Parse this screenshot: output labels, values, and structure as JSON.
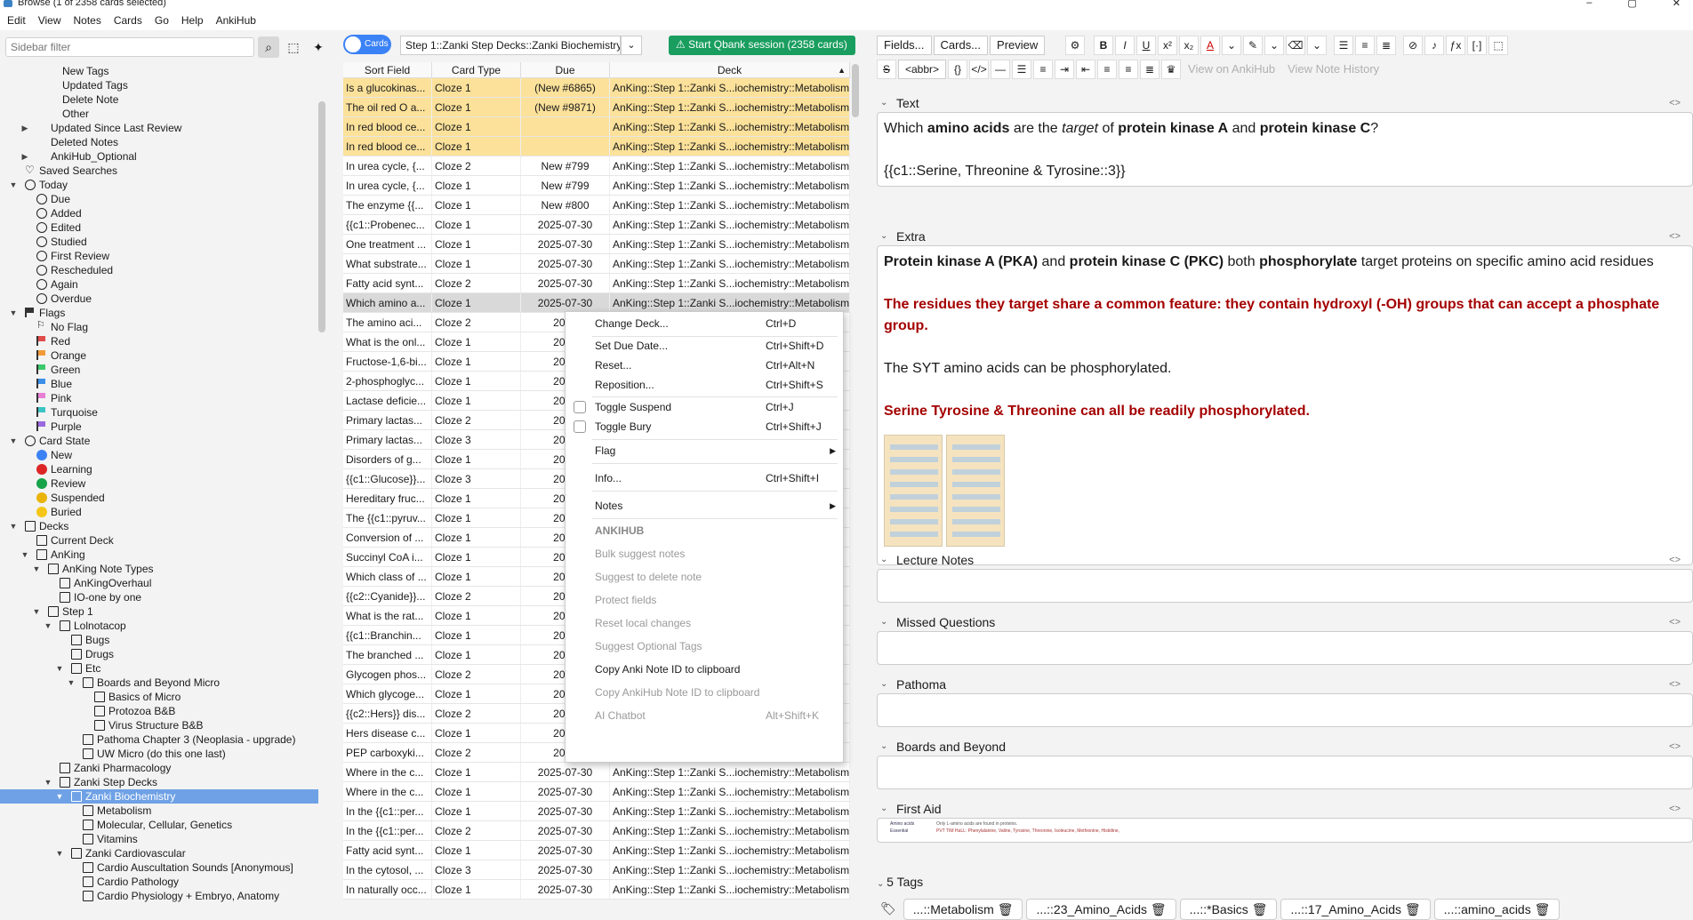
{
  "window": {
    "title": "Browse (1 of 2358 cards selected)"
  },
  "menu": [
    "Edit",
    "View",
    "Notes",
    "Cards",
    "Go",
    "Help",
    "AnkiHub"
  ],
  "sidebar": {
    "filter_placeholder": "Sidebar filter",
    "tree": [
      {
        "label": "New Tags",
        "level": 3,
        "icon": "none"
      },
      {
        "label": "Updated Tags",
        "level": 3,
        "icon": "none"
      },
      {
        "label": "Delete Note",
        "level": 3,
        "icon": "none"
      },
      {
        "label": "Other",
        "level": 3,
        "icon": "none"
      },
      {
        "label": "Updated Since Last Review",
        "level": 2,
        "icon": "none",
        "arrow": "right"
      },
      {
        "label": "Deleted Notes",
        "level": 2,
        "icon": "none"
      },
      {
        "label": "AnkiHub_Optional",
        "level": 2,
        "icon": "none",
        "arrow": "right"
      },
      {
        "label": "Saved Searches",
        "level": 1,
        "icon": "heart"
      },
      {
        "label": "Today",
        "level": 1,
        "icon": "clock",
        "arrow": "down"
      },
      {
        "label": "Due",
        "level": 2,
        "icon": "clock"
      },
      {
        "label": "Added",
        "level": 2,
        "icon": "clock"
      },
      {
        "label": "Edited",
        "level": 2,
        "icon": "clock"
      },
      {
        "label": "Studied",
        "level": 2,
        "icon": "clock"
      },
      {
        "label": "First Review",
        "level": 2,
        "icon": "clock"
      },
      {
        "label": "Rescheduled",
        "level": 2,
        "icon": "clock"
      },
      {
        "label": "Again",
        "level": 2,
        "icon": "clock"
      },
      {
        "label": "Overdue",
        "level": 2,
        "icon": "clock"
      },
      {
        "label": "Flags",
        "level": 1,
        "icon": "flag",
        "color": "#333333",
        "arrow": "down"
      },
      {
        "label": "No Flag",
        "level": 2,
        "icon": "noflag"
      },
      {
        "label": "Red",
        "level": 2,
        "icon": "flag",
        "color": "#e24b4b"
      },
      {
        "label": "Orange",
        "level": 2,
        "icon": "flag",
        "color": "#f29a38"
      },
      {
        "label": "Green",
        "level": 2,
        "icon": "flag",
        "color": "#3cc96b"
      },
      {
        "label": "Blue",
        "level": 2,
        "icon": "flag",
        "color": "#3b8fe8"
      },
      {
        "label": "Pink",
        "level": 2,
        "icon": "flag",
        "color": "#e77fd5"
      },
      {
        "label": "Turquoise",
        "level": 2,
        "icon": "flag",
        "color": "#3ac4c4"
      },
      {
        "label": "Purple",
        "level": 2,
        "icon": "flag",
        "color": "#9a6adf"
      },
      {
        "label": "Card State",
        "level": 1,
        "icon": "circle",
        "arrow": "down"
      },
      {
        "label": "New",
        "level": 2,
        "icon": "dot",
        "color": "#3b82f6"
      },
      {
        "label": "Learning",
        "level": 2,
        "icon": "dot",
        "color": "#dc2626"
      },
      {
        "label": "Review",
        "level": 2,
        "icon": "dot",
        "color": "#16a34a"
      },
      {
        "label": "Suspended",
        "level": 2,
        "icon": "dot",
        "color": "#eab308"
      },
      {
        "label": "Buried",
        "level": 2,
        "icon": "dot",
        "color": "#f5c518"
      },
      {
        "label": "Decks",
        "level": 1,
        "icon": "deck",
        "arrow": "down"
      },
      {
        "label": "Current Deck",
        "level": 2,
        "icon": "deck"
      },
      {
        "label": "AnKing",
        "level": 2,
        "icon": "deck",
        "arrow": "down"
      },
      {
        "label": "AnKing Note Types",
        "level": 3,
        "icon": "deck",
        "arrow": "down"
      },
      {
        "label": "AnKingOverhaul",
        "level": 4,
        "icon": "deck"
      },
      {
        "label": "IO-one by one",
        "level": 4,
        "icon": "deck"
      },
      {
        "label": "Step 1",
        "level": 3,
        "icon": "deck",
        "arrow": "down"
      },
      {
        "label": "Lolnotacop",
        "level": 4,
        "icon": "deck",
        "arrow": "down"
      },
      {
        "label": "Bugs",
        "level": 5,
        "icon": "deck"
      },
      {
        "label": "Drugs",
        "level": 5,
        "icon": "deck"
      },
      {
        "label": "Etc",
        "level": 5,
        "icon": "deck",
        "arrow": "down"
      },
      {
        "label": "Boards and Beyond Micro",
        "level": 6,
        "icon": "deck",
        "arrow": "down"
      },
      {
        "label": "Basics of Micro",
        "level": 7,
        "icon": "deck"
      },
      {
        "label": "Protozoa B&B",
        "level": 7,
        "icon": "deck"
      },
      {
        "label": "Virus Structure B&B",
        "level": 7,
        "icon": "deck"
      },
      {
        "label": "Pathoma Chapter 3 (Neoplasia - upgrade)",
        "level": 6,
        "icon": "deck"
      },
      {
        "label": "UW Micro (do this one last)",
        "level": 6,
        "icon": "deck"
      },
      {
        "label": "Zanki Pharmacology",
        "level": 4,
        "icon": "deck"
      },
      {
        "label": "Zanki Step Decks",
        "level": 4,
        "icon": "deck",
        "arrow": "down"
      },
      {
        "label": "Zanki Biochemistry",
        "level": 5,
        "icon": "deck",
        "arrow": "down",
        "selected": true
      },
      {
        "label": "Metabolism",
        "level": 6,
        "icon": "deck"
      },
      {
        "label": "Molecular, Cellular, Genetics",
        "level": 6,
        "icon": "deck"
      },
      {
        "label": "Vitamins",
        "level": 6,
        "icon": "deck"
      },
      {
        "label": "Zanki Cardiovascular",
        "level": 5,
        "icon": "deck",
        "arrow": "down"
      },
      {
        "label": "Cardio Auscultation Sounds [Anonymous]",
        "level": 6,
        "icon": "deck"
      },
      {
        "label": "Cardio Pathology",
        "level": 6,
        "icon": "deck"
      },
      {
        "label": "Cardio Physiology + Embryo, Anatomy",
        "level": 6,
        "icon": "deck"
      }
    ]
  },
  "toolbar": {
    "cards_toggle": "Cards",
    "deck_search": "Step 1::Zanki Step Decks::Zanki Biochemistry\"",
    "qbank_label": "Start Qbank session (2358 cards)"
  },
  "table": {
    "columns": [
      "Sort Field",
      "Card Type",
      "Due",
      "Deck"
    ],
    "rows": [
      {
        "sort": "Is a glucokinas...",
        "type": "Cloze 1",
        "due": "(New #6865)",
        "deck": "AnKing::Step 1::Zanki S...iochemistry::Metabolism",
        "state": "hl"
      },
      {
        "sort": "The oil red O a...",
        "type": "Cloze 1",
        "due": "(New #9871)",
        "deck": "AnKing::Step 1::Zanki S...iochemistry::Metabolism",
        "state": "hl"
      },
      {
        "sort": "In red blood ce...",
        "type": "Cloze 1",
        "due": "",
        "deck": "AnKing::Step 1::Zanki S...iochemistry::Metabolism",
        "state": "hl"
      },
      {
        "sort": "In red blood ce...",
        "type": "Cloze 1",
        "due": "",
        "deck": "AnKing::Step 1::Zanki S...iochemistry::Metabolism",
        "state": "hl"
      },
      {
        "sort": "In urea cycle, {...",
        "type": "Cloze 2",
        "due": "New #799",
        "deck": "AnKing::Step 1::Zanki S...iochemistry::Metabolism",
        "state": ""
      },
      {
        "sort": "In urea cycle, {...",
        "type": "Cloze 1",
        "due": "New #799",
        "deck": "AnKing::Step 1::Zanki S...iochemistry::Metabolism",
        "state": ""
      },
      {
        "sort": "The enzyme {{...",
        "type": "Cloze 1",
        "due": "New #800",
        "deck": "AnKing::Step 1::Zanki S...iochemistry::Metabolism",
        "state": ""
      },
      {
        "sort": "{{c1::Probenec...",
        "type": "Cloze 1",
        "due": "2025-07-30",
        "deck": "AnKing::Step 1::Zanki S...iochemistry::Metabolism",
        "state": ""
      },
      {
        "sort": "One treatment ...",
        "type": "Cloze 1",
        "due": "2025-07-30",
        "deck": "AnKing::Step 1::Zanki S...iochemistry::Metabolism",
        "state": ""
      },
      {
        "sort": "What substrate...",
        "type": "Cloze 1",
        "due": "2025-07-30",
        "deck": "AnKing::Step 1::Zanki S...iochemistry::Metabolism",
        "state": ""
      },
      {
        "sort": "Fatty acid synt...",
        "type": "Cloze 2",
        "due": "2025-07-30",
        "deck": "AnKing::Step 1::Zanki S...iochemistry::Metabolism",
        "state": ""
      },
      {
        "sort": "Which amino a...",
        "type": "Cloze 1",
        "due": "2025-07-30",
        "deck": "AnKing::Step 1::Zanki S...iochemistry::Metabolism",
        "state": "sel"
      },
      {
        "sort": "The amino aci...",
        "type": "Cloze 2",
        "due": "2025",
        "deck": "",
        "state": ""
      },
      {
        "sort": "What is the onl...",
        "type": "Cloze 1",
        "due": "2025",
        "deck": "",
        "state": ""
      },
      {
        "sort": "Fructose-1,6-bi...",
        "type": "Cloze 1",
        "due": "2025",
        "deck": "",
        "state": ""
      },
      {
        "sort": "2-phosphoglyc...",
        "type": "Cloze 1",
        "due": "2025",
        "deck": "",
        "state": ""
      },
      {
        "sort": "Lactase deficie...",
        "type": "Cloze 1",
        "due": "2025",
        "deck": "",
        "state": ""
      },
      {
        "sort": "Primary lactas...",
        "type": "Cloze 2",
        "due": "2025",
        "deck": "",
        "state": ""
      },
      {
        "sort": "Primary lactas...",
        "type": "Cloze 3",
        "due": "2025",
        "deck": "",
        "state": ""
      },
      {
        "sort": "Disorders of g...",
        "type": "Cloze 1",
        "due": "2025",
        "deck": "",
        "state": ""
      },
      {
        "sort": "{{c1::Glucose}}...",
        "type": "Cloze 3",
        "due": "2025",
        "deck": "",
        "state": ""
      },
      {
        "sort": "Hereditary fruc...",
        "type": "Cloze 1",
        "due": "2025",
        "deck": "",
        "state": ""
      },
      {
        "sort": "The {{c1::pyruv...",
        "type": "Cloze 1",
        "due": "2025",
        "deck": "",
        "state": ""
      },
      {
        "sort": "Conversion of ...",
        "type": "Cloze 1",
        "due": "2025",
        "deck": "",
        "state": ""
      },
      {
        "sort": "Succinyl CoA i...",
        "type": "Cloze 1",
        "due": "2025",
        "deck": "",
        "state": ""
      },
      {
        "sort": "Which class of ...",
        "type": "Cloze 1",
        "due": "2025",
        "deck": "",
        "state": ""
      },
      {
        "sort": "{{c2::Cyanide}}...",
        "type": "Cloze 2",
        "due": "2025",
        "deck": "",
        "state": ""
      },
      {
        "sort": "What is the rat...",
        "type": "Cloze 1",
        "due": "2025",
        "deck": "",
        "state": ""
      },
      {
        "sort": "{{c1::Branchin...",
        "type": "Cloze 1",
        "due": "2025",
        "deck": "",
        "state": ""
      },
      {
        "sort": "The branched ...",
        "type": "Cloze 1",
        "due": "2025",
        "deck": "",
        "state": ""
      },
      {
        "sort": "Glycogen phos...",
        "type": "Cloze 2",
        "due": "2025",
        "deck": "",
        "state": ""
      },
      {
        "sort": "Which glycoge...",
        "type": "Cloze 1",
        "due": "2025",
        "deck": "",
        "state": ""
      },
      {
        "sort": "{{c2::Hers}} dis...",
        "type": "Cloze 2",
        "due": "2025",
        "deck": "",
        "state": ""
      },
      {
        "sort": "Hers disease c...",
        "type": "Cloze 1",
        "due": "2025",
        "deck": "",
        "state": ""
      },
      {
        "sort": "PEP carboxyki...",
        "type": "Cloze 2",
        "due": "2025",
        "deck": "",
        "state": ""
      },
      {
        "sort": "Where in the c...",
        "type": "Cloze 1",
        "due": "2025-07-30",
        "deck": "AnKing::Step 1::Zanki S...iochemistry::Metabolism",
        "state": ""
      },
      {
        "sort": "Where in the c...",
        "type": "Cloze 1",
        "due": "2025-07-30",
        "deck": "AnKing::Step 1::Zanki S...iochemistry::Metabolism",
        "state": ""
      },
      {
        "sort": "In the {{c1::per...",
        "type": "Cloze 1",
        "due": "2025-07-30",
        "deck": "AnKing::Step 1::Zanki S...iochemistry::Metabolism",
        "state": ""
      },
      {
        "sort": "In the {{c1::per...",
        "type": "Cloze 2",
        "due": "2025-07-30",
        "deck": "AnKing::Step 1::Zanki S...iochemistry::Metabolism",
        "state": ""
      },
      {
        "sort": "Fatty acid synt...",
        "type": "Cloze 1",
        "due": "2025-07-30",
        "deck": "AnKing::Step 1::Zanki S...iochemistry::Metabolism",
        "state": ""
      },
      {
        "sort": "In the cytosol, ...",
        "type": "Cloze 3",
        "due": "2025-07-30",
        "deck": "AnKing::Step 1::Zanki S...iochemistry::Metabolism",
        "state": ""
      },
      {
        "sort": "In naturally occ...",
        "type": "Cloze 1",
        "due": "2025-07-30",
        "deck": "AnKing::Step 1::Zanki S...iochemistry::Metabolism",
        "state": ""
      }
    ]
  },
  "context_menu": {
    "items": [
      {
        "label": "Change Deck...",
        "shortcut": "Ctrl+D"
      },
      {
        "label": "Set Due Date...",
        "shortcut": "Ctrl+Shift+D"
      },
      {
        "label": "Reset...",
        "shortcut": "Ctrl+Alt+N"
      },
      {
        "label": "Reposition...",
        "shortcut": "Ctrl+Shift+S"
      },
      {
        "label": "Toggle Suspend",
        "shortcut": "Ctrl+J"
      },
      {
        "label": "Toggle Bury",
        "shortcut": "Ctrl+Shift+J"
      },
      {
        "label": "Flag",
        "shortcut": ""
      },
      {
        "label": "Info...",
        "shortcut": "Ctrl+Shift+I"
      },
      {
        "label": "Notes",
        "shortcut": ""
      }
    ],
    "ankihub_header": "ANKIHUB",
    "ankihub_items": [
      {
        "label": "Bulk suggest notes",
        "shortcut": ""
      },
      {
        "label": "Suggest to delete note",
        "shortcut": ""
      },
      {
        "label": "Protect fields",
        "shortcut": ""
      },
      {
        "label": "Reset local changes",
        "shortcut": ""
      },
      {
        "label": "Suggest Optional Tags",
        "shortcut": ""
      },
      {
        "label": "Copy Anki Note ID to clipboard",
        "shortcut": ""
      },
      {
        "label": "Copy AnkiHub Note ID to clipboard",
        "shortcut": ""
      },
      {
        "label": "AI Chatbot",
        "shortcut": "Alt+Shift+K"
      }
    ]
  },
  "editor": {
    "buttons": [
      "Fields...",
      "Cards...",
      "Preview"
    ],
    "abbr": "<abbr>",
    "view_on_ankihub": "View on AnkiHub",
    "view_note_history": "View Note History",
    "fields": [
      {
        "name": "Text"
      },
      {
        "name": "Extra"
      },
      {
        "name": "Lecture Notes"
      },
      {
        "name": "Missed Questions"
      },
      {
        "name": "Pathoma"
      },
      {
        "name": "Boards and Beyond"
      },
      {
        "name": "First Aid"
      }
    ],
    "text_field": {
      "p1": "Which ",
      "b1": "amino acids",
      "p2": " are the ",
      "i1": "target",
      "p3": " of ",
      "b2": "protein kinase A",
      "p4": " and ",
      "b3": "protein kinase C",
      "p5": "?",
      "cloze": "{{c1::Serine, Threonine & Tyrosine::3}}"
    },
    "extra_field": {
      "b1": "Protein kinase A (PKA)",
      "p1": " and ",
      "b2": "protein kinase C (PKC)",
      "p2": " both ",
      "b3": "phosphorylate",
      "p3": " target proteins on specific amino acid residues",
      "red1": "The residues they target share a common feature: they contain hydroxyl (-OH) groups that can accept a phosphate group.",
      "plain": "The SYT amino acids can be phosphorylated.",
      "red2": "Serine Tyrosine & Threonine can all be readily phosphorylated."
    },
    "first_aid_snippet": {
      "line1": "Amino acids",
      "line2": "Essential",
      "rhs1": "Only L-amino acids are found in proteins.",
      "rhs2": "PVT TIM HaLL: Phenylalanine, Valine, Tyrosine, Threonine, Isoleucine, Methionine, Histidine,"
    },
    "tags_title": "5 Tags",
    "tags": [
      "...::Metabolism",
      "...::23_Amino_Acids",
      "...::*Basics",
      "...::17_Amino_Acids",
      "...::amino_acids"
    ]
  }
}
